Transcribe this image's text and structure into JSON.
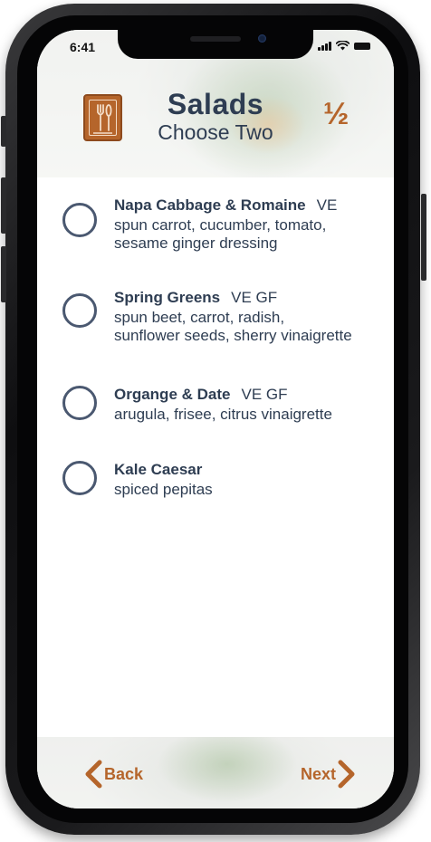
{
  "status_bar": {
    "time": "6:41"
  },
  "header": {
    "title": "Salads",
    "subtitle": "Choose Two",
    "step": "½",
    "icon": "menu-utensils-icon"
  },
  "options": [
    {
      "name": "Napa Cabbage & Romaine",
      "tags": "VE",
      "desc_lines": [
        "spun carrot, cucumber, tomato,",
        "sesame ginger dressing"
      ]
    },
    {
      "name": "Spring Greens",
      "tags": "VE  GF",
      "desc_lines": [
        "spun beet, carrot, radish,",
        "sunflower seeds, sherry vinaigrette"
      ]
    },
    {
      "name": "Organge & Date",
      "tags": "VE  GF",
      "desc_lines": [
        "arugula, frisee, citrus vinaigrette"
      ]
    },
    {
      "name": "Kale Caesar",
      "tags": "",
      "desc_lines": [
        "spiced pepitas"
      ]
    }
  ],
  "footer": {
    "back_label": "Back",
    "next_label": "Next"
  },
  "colors": {
    "accent": "#b5652b",
    "text": "#2e3d52",
    "radio": "#4a5870"
  }
}
